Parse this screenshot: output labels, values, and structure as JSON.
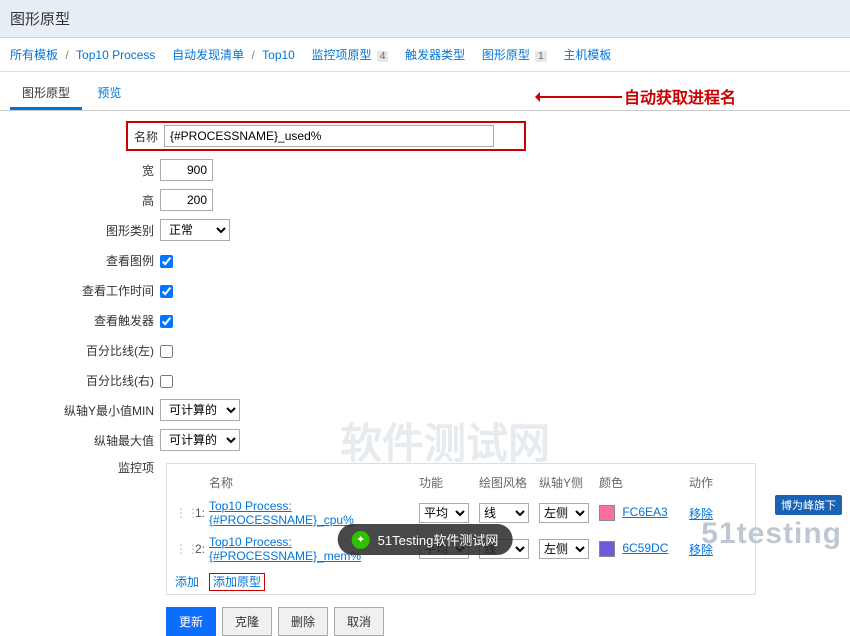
{
  "header": {
    "title": "图形原型"
  },
  "breadcrumb": {
    "all_templates": "所有模板",
    "template_name": "Top10 Process",
    "discovery": "自动发现清单",
    "discovery_name": "Top10",
    "item_proto": "监控项原型",
    "item_proto_count": "4",
    "trigger_proto": "触发器类型",
    "graph_proto": "图形原型",
    "graph_proto_count": "1",
    "host_proto": "主机模板"
  },
  "tabs": {
    "graph_proto": "图形原型",
    "preview": "预览"
  },
  "form": {
    "name_label": "名称",
    "name_value": "{#PROCESSNAME}_used%",
    "width_label": "宽",
    "width_value": "900",
    "height_label": "高",
    "height_value": "200",
    "type_label": "图形类别",
    "type_value": "正常",
    "legend_label": "查看图例",
    "worktime_label": "查看工作时间",
    "trigger_label": "查看触发器",
    "pline_left_label": "百分比线(左)",
    "pline_right_label": "百分比线(右)",
    "ymin_label": "纵轴Y最小值MIN",
    "ymin_value": "可计算的",
    "ymax_label": "纵轴最大值",
    "ymax_value": "可计算的",
    "items_label": "监控项"
  },
  "items": {
    "head": {
      "name": "名称",
      "func": "功能",
      "draw": "绘图风格",
      "yaxis": "纵轴Y侧",
      "color": "颜色",
      "action": "动作"
    },
    "rows": [
      {
        "idx": "1:",
        "name": "Top10 Process: {#PROCESSNAME}_cpu%",
        "func": "平均",
        "draw": "线",
        "yaxis": "左侧",
        "color_hex": "FC6EA3",
        "color_css": "#FC6EA3",
        "action": "移除"
      },
      {
        "idx": "2:",
        "name": "Top10 Process: {#PROCESSNAME}_mem%",
        "func": "平均",
        "draw": "线",
        "yaxis": "左侧",
        "color_hex": "6C59DC",
        "color_css": "#6C59DC",
        "action": "移除"
      }
    ],
    "add": "添加",
    "add_proto": "添加原型"
  },
  "buttons": {
    "update": "更新",
    "clone": "克隆",
    "delete": "删除",
    "cancel": "取消"
  },
  "annotation": {
    "text": "自动获取进程名"
  },
  "watermark": {
    "badge": "博为峰旗下",
    "brand": "51testing",
    "bg": "软件测试网"
  },
  "wechat": {
    "label": "51Testing软件测试网"
  }
}
